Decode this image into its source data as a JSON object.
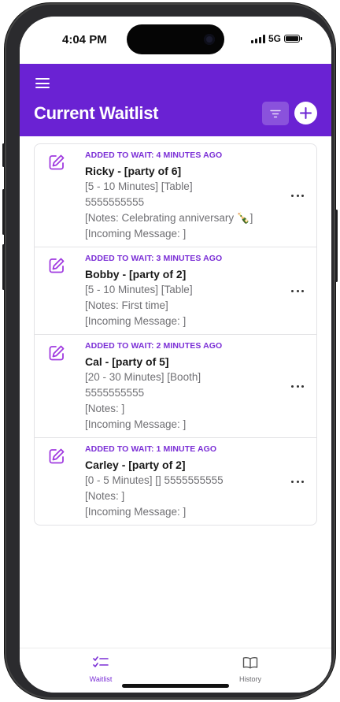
{
  "status_bar": {
    "time": "4:04 PM",
    "network": "5G"
  },
  "header": {
    "title": "Current Waitlist",
    "background_color": "#6a22d3",
    "icons": [
      "menu-icon",
      "filter-icon",
      "plus-icon"
    ]
  },
  "waitlist": [
    {
      "added": "ADDED TO WAIT: 4 MINUTES AGO",
      "name": "Ricky - [party of 6]",
      "lines": [
        "[5 - 10 Minutes]  [Table]",
        "5555555555",
        "[Notes: Celebrating anniversary 🍾]",
        "[Incoming Message: ]"
      ]
    },
    {
      "added": "ADDED TO WAIT: 3 MINUTES AGO",
      "name": "Bobby - [party of 2]",
      "lines": [
        "[5 - 10 Minutes]  [Table]",
        "[Notes: First time]",
        "[Incoming Message: ]"
      ]
    },
    {
      "added": "ADDED TO WAIT: 2 MINUTES AGO",
      "name": "Cal  - [party of 5]",
      "lines": [
        "[20 - 30 Minutes]  [Booth]",
        "5555555555",
        "[Notes: ]",
        "[Incoming Message: ]"
      ]
    },
    {
      "added": "ADDED TO WAIT: 1 MINUTE AGO",
      "name": "Carley - [party of 2]",
      "lines": [
        "[0 - 5 Minutes]  []  5555555555",
        "[Notes: ]",
        "[Incoming Message: ]"
      ]
    }
  ],
  "tabbar": {
    "waitlist_label": "Waitlist",
    "history_label": "History",
    "active_tab": "Waitlist",
    "active_color": "#7b2fd6"
  }
}
